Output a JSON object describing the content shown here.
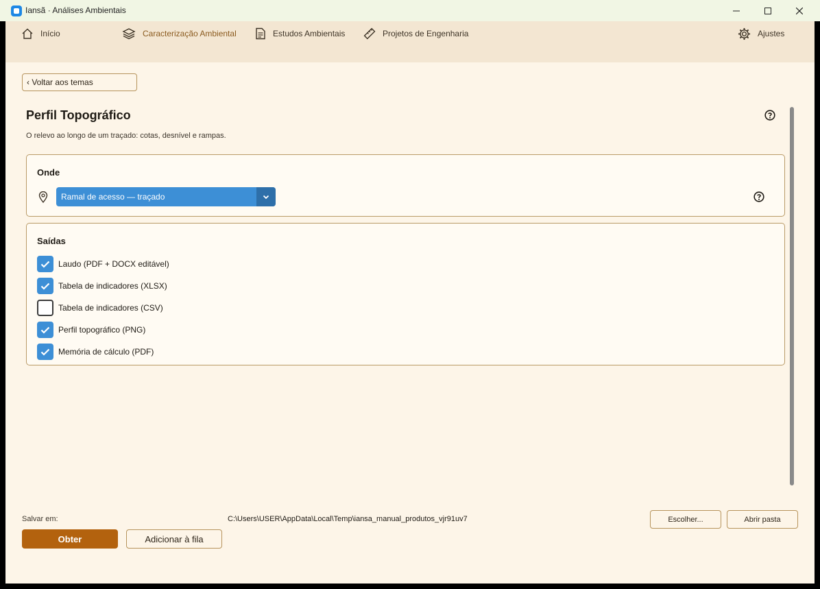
{
  "window": {
    "title": "Iansã · Análises Ambientais",
    "controls": [
      "minimize-icon",
      "maximize-icon",
      "close-icon"
    ]
  },
  "nav": {
    "items": [
      {
        "label": "Início",
        "icon": "home-icon"
      },
      {
        "label": "Caracterização Ambiental",
        "icon": "layers-icon",
        "active": true
      },
      {
        "label": "Estudos Ambientais",
        "icon": "document-icon"
      },
      {
        "label": "Projetos de Engenharia",
        "icon": "ruler-icon"
      }
    ],
    "settings": {
      "label": "Ajustes",
      "icon": "gear-icon"
    }
  },
  "back_button": "‹ Voltar aos temas",
  "page": {
    "title": "Perfil Topográfico",
    "subtitle": "O relevo ao longo de um traçado: cotas, desnível e rampas."
  },
  "onde": {
    "title": "Onde",
    "icon": "map-pin-icon",
    "selected": "Ramal de acesso — traçado"
  },
  "saidas": {
    "title": "Saídas",
    "items": [
      {
        "label": "Laudo (PDF + DOCX editável)",
        "checked": true
      },
      {
        "label": "Tabela de indicadores (XLSX)",
        "checked": true
      },
      {
        "label": "Tabela de indicadores (CSV)",
        "checked": false
      },
      {
        "label": "Perfil topográfico (PNG)",
        "checked": true
      },
      {
        "label": "Memória de cálculo (PDF)",
        "checked": true
      }
    ]
  },
  "footer": {
    "save_label": "Salvar em:",
    "save_path": "C:\\Users\\USER\\AppData\\Local\\Temp\\iansa_manual_produtos_vjr91uv7",
    "choose_button": "Escolher...",
    "open_folder_button": "Abrir pasta",
    "primary_button": "Obter",
    "queue_button": "Adicionar à fila"
  },
  "colors": {
    "accent_blue": "#3d8fd6",
    "primary_orange": "#b3620e",
    "background": "#fdf5e8",
    "nav_background": "#f3e6d2"
  }
}
